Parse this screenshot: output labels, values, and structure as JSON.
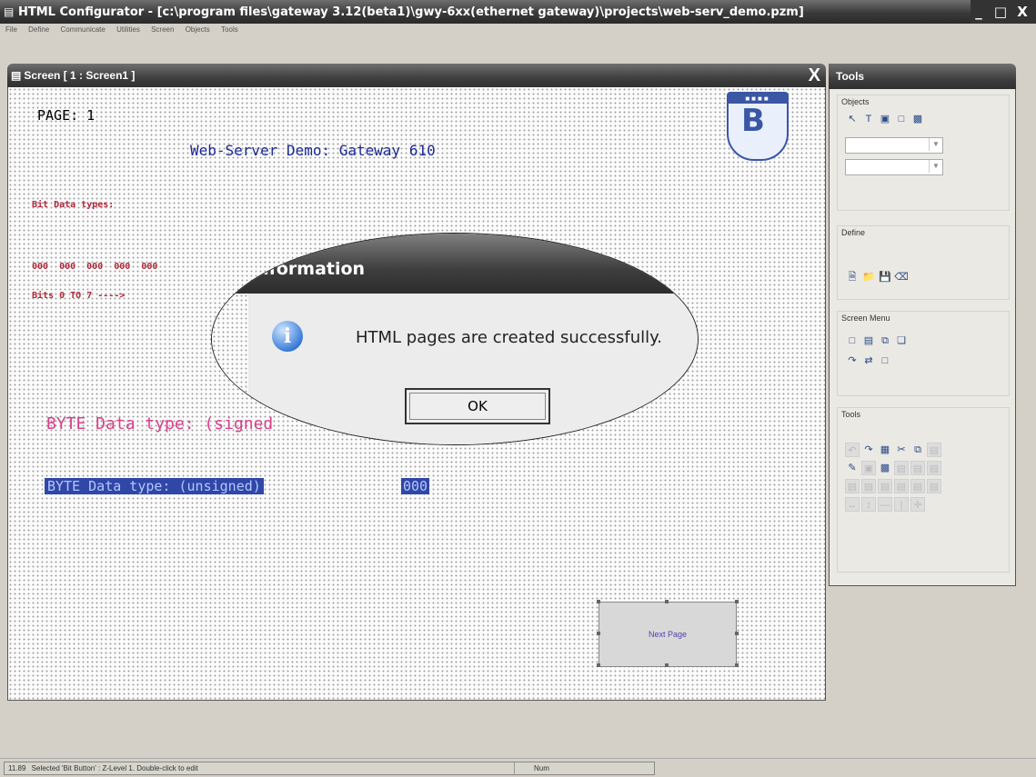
{
  "app": {
    "title": "HTML Configurator - [c:\\program files\\gateway 3.12(beta1)\\gwy-6xx(ethernet gateway)\\projects\\web-serv_demo.pzm]",
    "window_buttons": [
      "_",
      "□",
      "X"
    ]
  },
  "menu": [
    "File",
    "Define",
    "Communicate",
    "Utilities",
    "Screen",
    "Objects",
    "Tools"
  ],
  "screen_window": {
    "title": "Screen [ 1 : Screen1 ]",
    "close": "X"
  },
  "canvas": {
    "page_label": "PAGE: 1",
    "demo_title": "Web-Server Demo: Gateway 610",
    "bit_types": "Bit Data types:",
    "bit_row": "000 000 000 000 000",
    "bits_range": "Bits 0 TO 7 ---->",
    "byte_signed": "BYTE Data type: (signed",
    "byte_unsigned": "BYTE Data type: (unsigned)",
    "byte_value": "000",
    "next_page_button": "Next Page",
    "logo_text": "B"
  },
  "dialog": {
    "title": "Information",
    "message": "HTML pages are created successfully.",
    "ok": "OK"
  },
  "tools": {
    "title": "Tools",
    "groups": {
      "objects": "Objects",
      "define": "Define",
      "screen_menu": "Screen Menu",
      "tools": "Tools"
    }
  },
  "status": {
    "coords": "11.89",
    "text": "Selected 'Bit Button' : Z-Level 1. Double-click to edit",
    "num": "Num"
  },
  "colors": {
    "title_bar": "#3a3a3a",
    "canvas_bg": "#fbfbfb",
    "demo_title": "#1c2a96",
    "bit_text": "#b1283a",
    "byte_signed": "#d9408a",
    "byte_unsigned_bg": "#2f47a6"
  }
}
